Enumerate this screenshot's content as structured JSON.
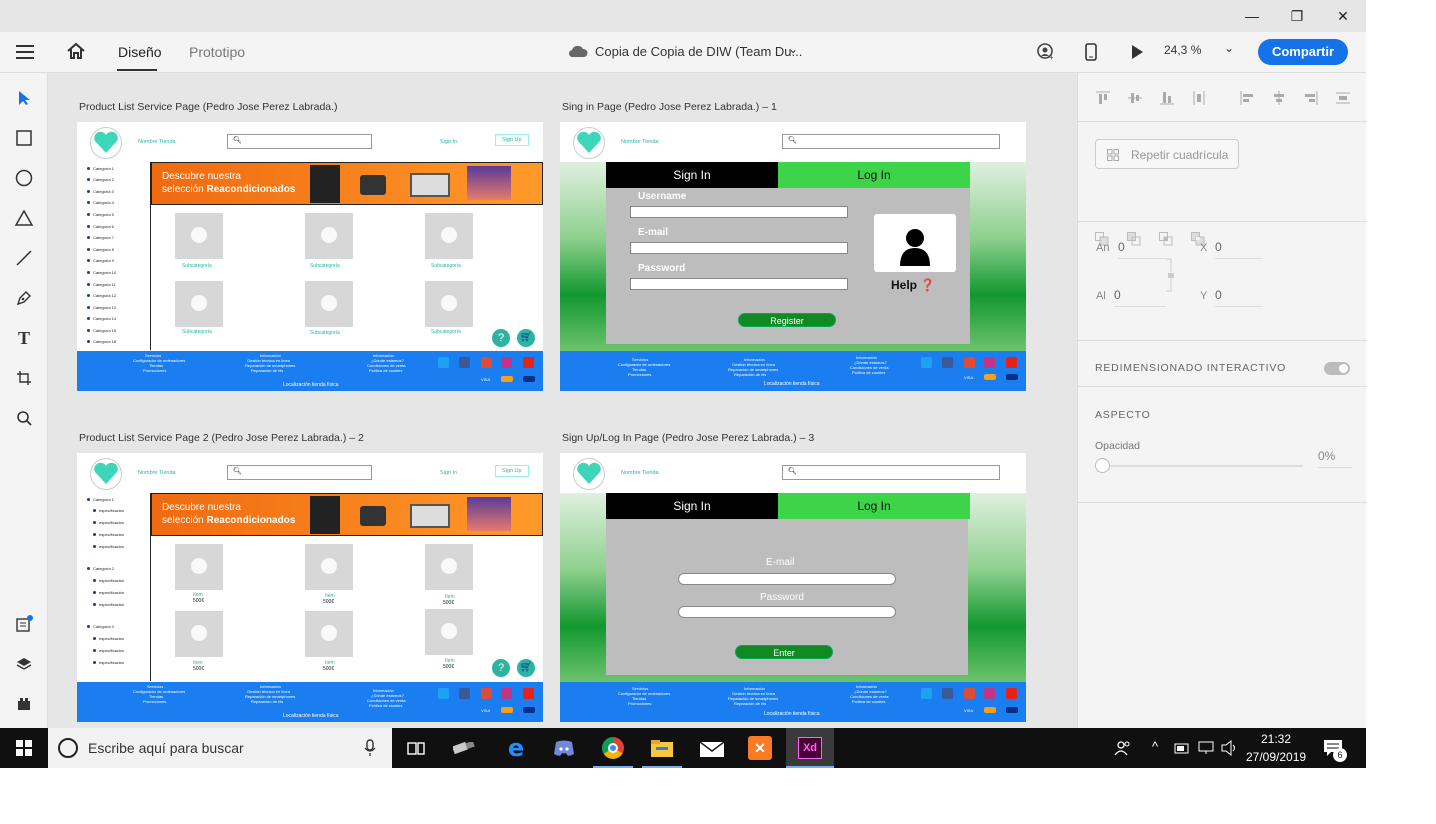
{
  "window": {
    "minimize": "—",
    "restore": "❐",
    "close": "✕"
  },
  "menubar": {
    "tabs": [
      {
        "label": "Diseño"
      },
      {
        "label": "Prototipo"
      }
    ],
    "doc_title": "Copia de Copia de DIW (Team Du...",
    "zoom": "24,3 %",
    "share_label": "Compartir"
  },
  "artboards": [
    {
      "label": "Product List Service Page (Pedro Jose Perez Labrada.)"
    },
    {
      "label": "Sing in Page (Pedro Jose Perez Labrada.) – 1"
    },
    {
      "label": "Product List Service Page 2 (Pedro Jose Perez Labrada.) – 2"
    },
    {
      "label": "Sign Up/Log In Page (Pedro Jose Perez Labrada.) – 3"
    }
  ],
  "mock": {
    "store_name": "Nombre Tienda",
    "sign_in": "Sign In",
    "sign_up": "Sign Up",
    "banner_line1": "Descubre nuestra",
    "banner_line2a": "selección ",
    "banner_line2b": "Reacondicionados",
    "categories": [
      "Categoría 1",
      "Categoría 2",
      "Categoría 3",
      "Categoría 4",
      "Categoría 5",
      "Categoría 6",
      "Categoría 7",
      "Categoría 8",
      "Categoría 9",
      "Categoría 10",
      "Categoría 11",
      "Categoría 12",
      "Categoría 13",
      "Categoría 14",
      "Categoría 15",
      "Categoría 16"
    ],
    "subcategory": "Subcategoría",
    "categories2": [
      "Categoría 1",
      "Categoría 2",
      "Categoría 3"
    ],
    "spec": "especificación",
    "item": "Item",
    "price": "500€",
    "footer_col1": [
      "Servicios",
      "Configurador de ordenadores",
      "Tiendas",
      "Promociones"
    ],
    "footer_col2": [
      "Información",
      "Gestión técnica en línea",
      "Reparación de smartphones",
      "Reparación de rils"
    ],
    "footer_col3": [
      "Información",
      "¿Dónde estamos?",
      "Condiciones de venta",
      "Política de cookies"
    ],
    "footer_loc": "Localización tienda física",
    "visa": "VISA",
    "tab_signin": "Sign In",
    "tab_login": "Log In",
    "username": "Username",
    "email": "E-mail",
    "password": "Password",
    "register": "Register",
    "help": "Help ❓",
    "enter": "Enter"
  },
  "panel": {
    "repeat_grid": "Repetir cuadrícula",
    "w_label": "An",
    "w": "0",
    "h_label": "Al",
    "h": "0",
    "x_label": "X",
    "x": "0",
    "y_label": "Y",
    "y": "0",
    "responsive": "REDIMENSIONADO INTERACTIVO",
    "aspect": "ASPECTO",
    "opacity_label": "Opacidad",
    "opacity": "0%"
  },
  "taskbar": {
    "search_placeholder": "Escribe aquí para buscar",
    "time": "21:32",
    "date": "27/09/2019",
    "notif_count": "6"
  },
  "colors": {
    "accent": "#1473e6",
    "green": "#3ed44a",
    "footer": "#1a7ef0",
    "orange": "#f06a10"
  }
}
